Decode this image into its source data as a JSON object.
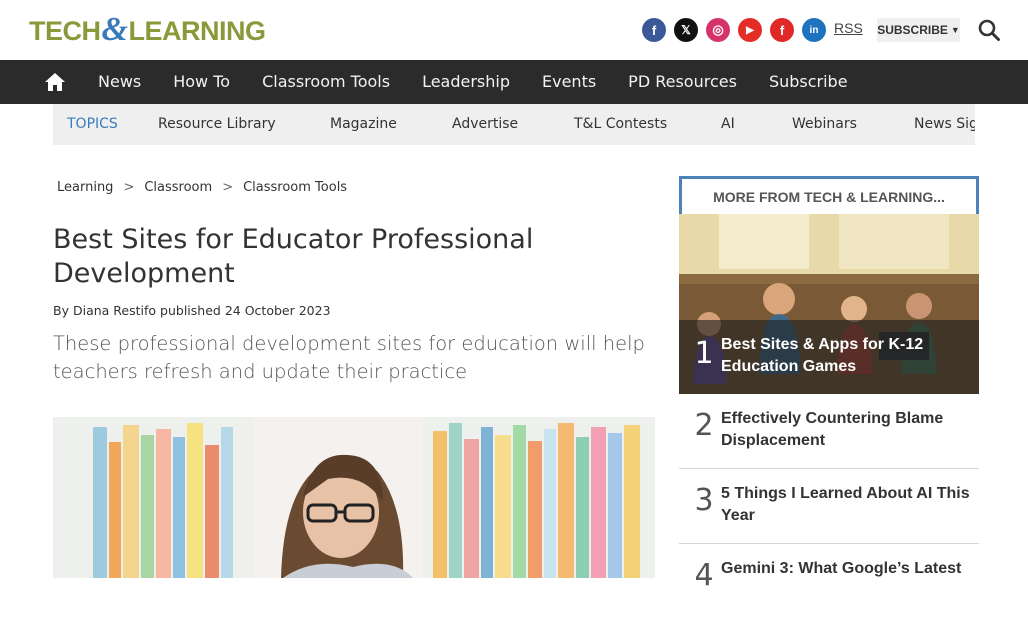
{
  "brand": {
    "logo_left": "TECH",
    "logo_amp": "&",
    "logo_right": "LEARNING"
  },
  "social": [
    {
      "name": "facebook",
      "glyph": "f",
      "color": "#3b5998"
    },
    {
      "name": "x",
      "glyph": "𝕏",
      "color": "#111111"
    },
    {
      "name": "instagram",
      "glyph": "◎",
      "color": "#d6336c"
    },
    {
      "name": "youtube",
      "glyph": "▶",
      "color": "#e52d27"
    },
    {
      "name": "flipboard",
      "glyph": "f",
      "color": "#e12828"
    },
    {
      "name": "linkedin",
      "glyph": "in",
      "color": "#1e73be"
    }
  ],
  "header": {
    "rss": "RSS",
    "subscribe": "SUBSCRIBE"
  },
  "nav": {
    "items": [
      "News",
      "How To",
      "Classroom Tools",
      "Leadership",
      "Events",
      "PD Resources",
      "Subscribe"
    ]
  },
  "topics": {
    "label": "TOPICS",
    "items": [
      "Resource Library",
      "Magazine",
      "Advertise",
      "T&L Contests",
      "AI",
      "Webinars",
      "News Sig"
    ]
  },
  "breadcrumb": [
    "Learning",
    "Classroom",
    "Classroom Tools"
  ],
  "article": {
    "title": "Best Sites for Educator Professional Development",
    "by": "By",
    "author": "Diana Restifo",
    "published": "published",
    "date": "24 October 2023",
    "strap": "These professional development sites for education will help teachers refresh and update their practice"
  },
  "sidebar": {
    "heading": "MORE FROM TECH & LEARNING...",
    "items": [
      {
        "num": "1",
        "title": "Best Sites & Apps for K-12 Education Games"
      },
      {
        "num": "2",
        "title": "Effectively Countering Blame Displacement"
      },
      {
        "num": "3",
        "title": "5 Things I Learned About AI This Year"
      },
      {
        "num": "4",
        "title": "Gemini 3: What Google’s Latest"
      }
    ]
  }
}
